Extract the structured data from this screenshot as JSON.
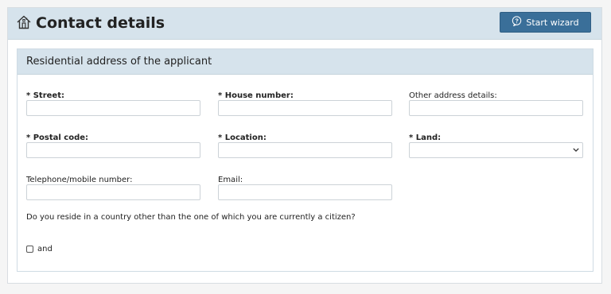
{
  "header": {
    "title": "Contact details",
    "wizard_button": "Start wizard"
  },
  "section": {
    "title": "Residential address of the applicant"
  },
  "fields": {
    "street": {
      "label": "* Street:",
      "value": ""
    },
    "house_number": {
      "label": "* House number:",
      "value": ""
    },
    "other_details": {
      "label": "Other address details:",
      "value": ""
    },
    "postal_code": {
      "label": "* Postal code:",
      "value": ""
    },
    "location": {
      "label": "* Location:",
      "value": ""
    },
    "land": {
      "label": "* Land:",
      "value": ""
    },
    "telephone": {
      "label": "Telephone/mobile number:",
      "value": ""
    },
    "email": {
      "label": "Email:",
      "value": ""
    }
  },
  "question": "Do you reside in a country other than the one of which you are currently a citizen?",
  "checkbox": {
    "label": "and",
    "checked": false
  },
  "colors": {
    "header_bg": "#d6e3ec",
    "button_bg": "#3a6f99"
  },
  "icons": {
    "title": "home-icon",
    "wizard": "chat-bubble-icon",
    "select": "chevron-down-icon"
  }
}
